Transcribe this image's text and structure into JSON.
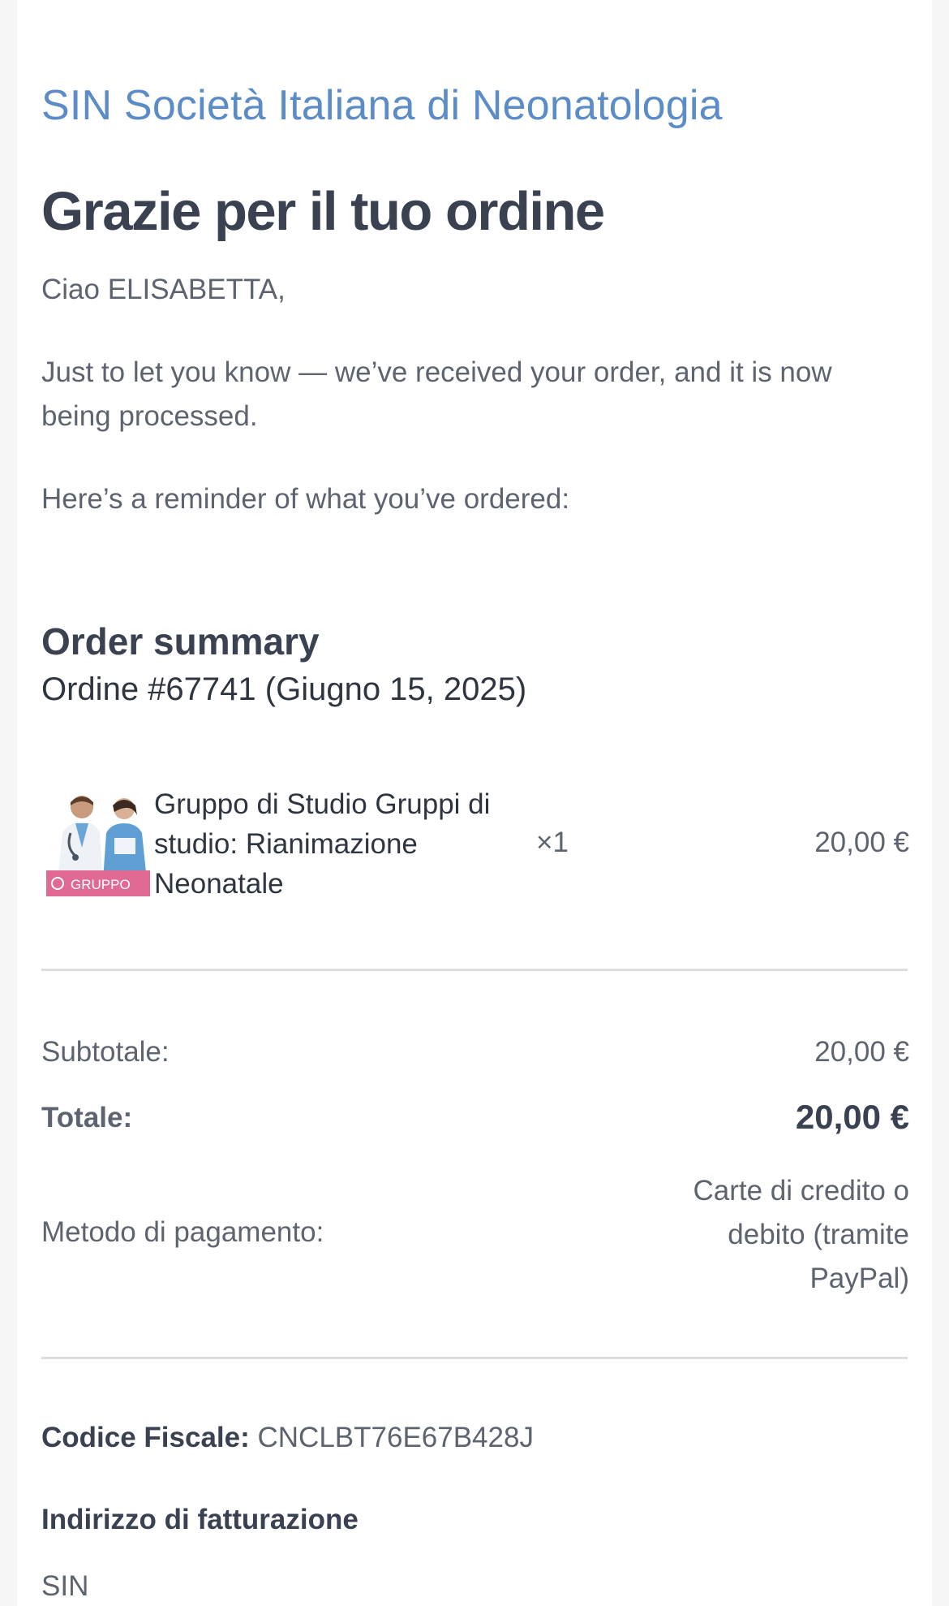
{
  "email": {
    "store_name": "SIN Società Italiana di Neonatologia",
    "heading": "Grazie per il tuo ordine",
    "greeting": "Ciao ELISABETTA,",
    "intro": "Just to let you know — we’ve received your order, and it is now being processed.",
    "reminder": "Here’s a reminder of what you’ve ordered:"
  },
  "order": {
    "summary_title": "Order summary",
    "order_line": "Ordine #67741 (Giugno 15, 2025)",
    "items": [
      {
        "name": "Gruppo di Studio Gruppi di studio: Rianimazione Neonatale",
        "qty": "×1",
        "price": "20,00 €",
        "thumb_badge": "GRUPPO",
        "thumb_icon": "doctors-photo-icon"
      }
    ],
    "subtotal_label": "Subtotale:",
    "subtotal_value": "20,00 €",
    "total_label": "Totale:",
    "total_value": "20,00 €",
    "payment_label": "Metodo di pagamento:",
    "payment_value": "Carte di credito o debito (tramite PayPal)"
  },
  "billing": {
    "codice_label": "Codice Fiscale:",
    "codice_value": " CNCLBT76E67B428J",
    "title": "Indirizzo di fatturazione",
    "line1": "SIN"
  },
  "colors": {
    "accent": "#5b8cc8",
    "heading": "#3a4150",
    "text": "#5d6470",
    "badge": "#e06a93"
  }
}
